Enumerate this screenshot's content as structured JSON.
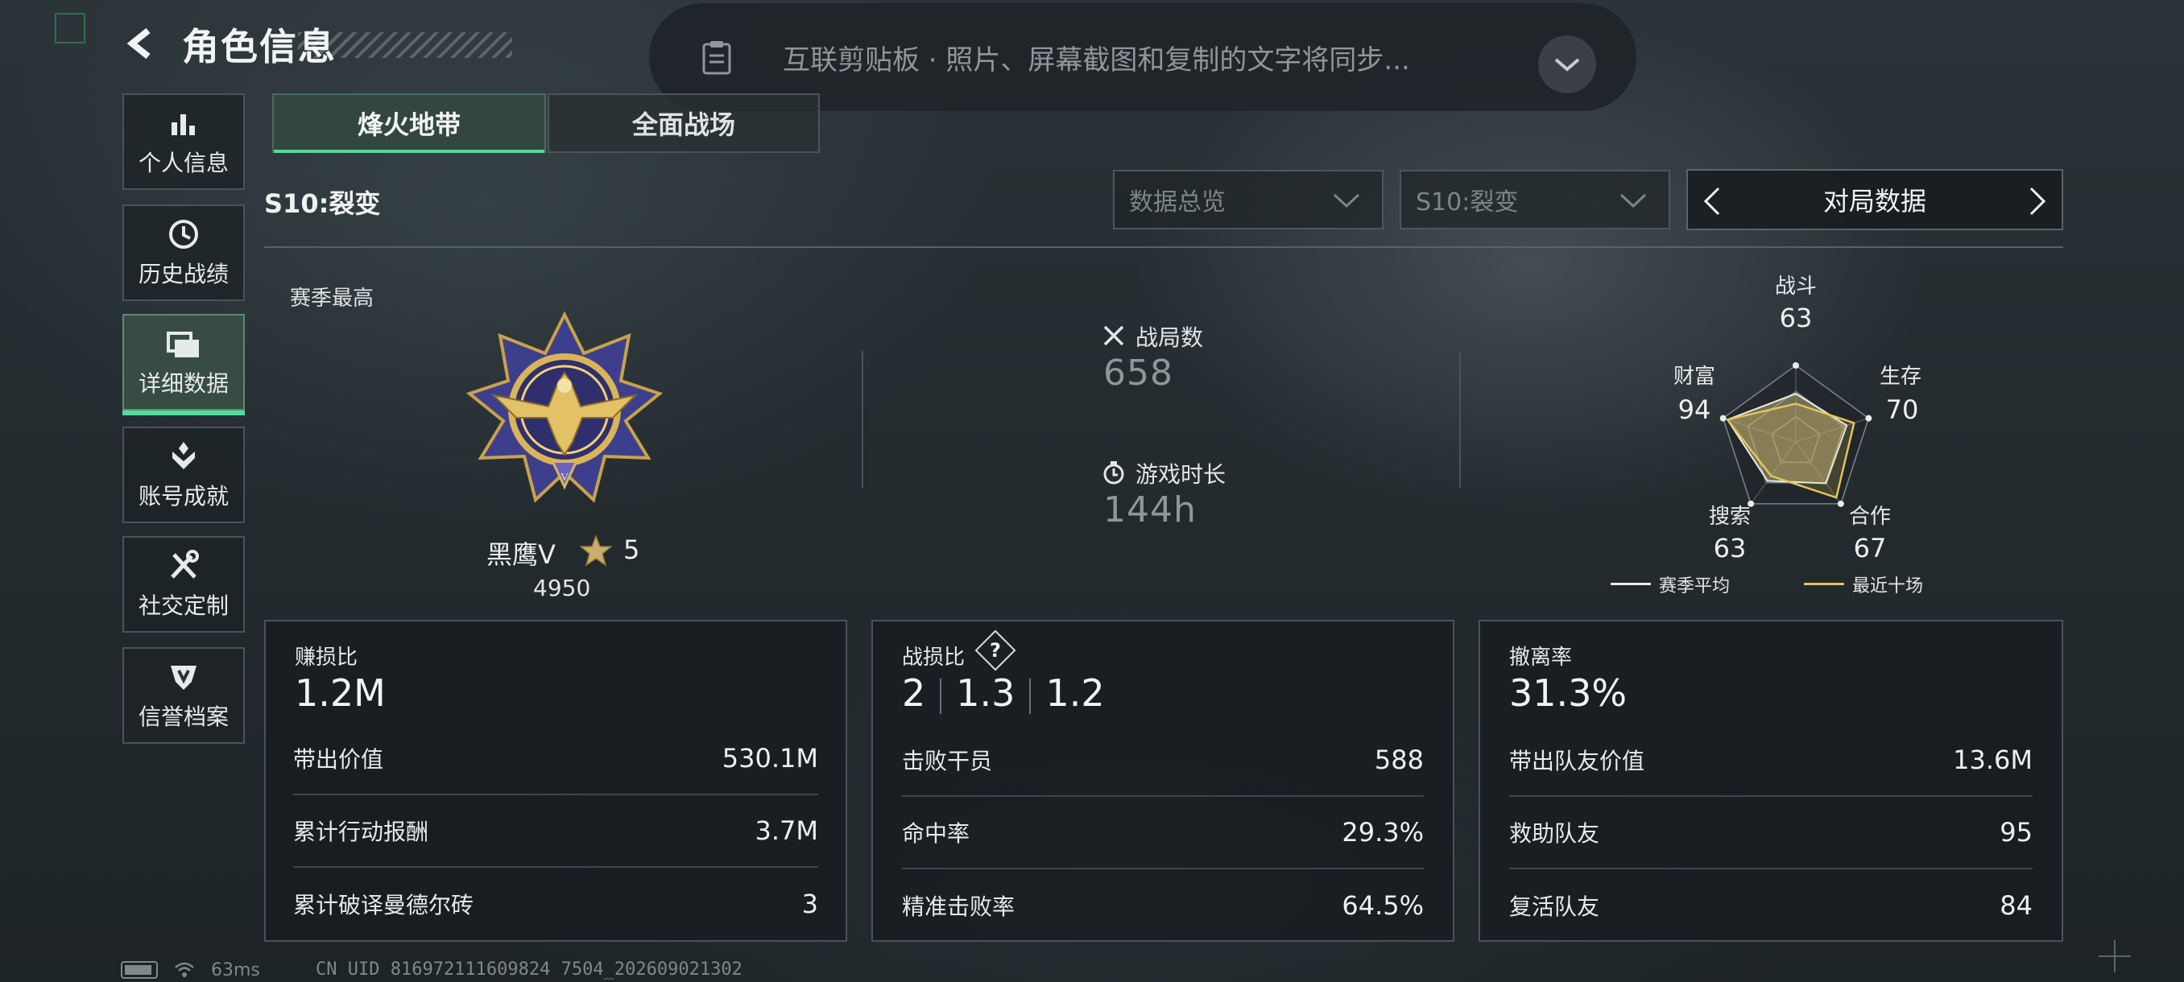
{
  "header": {
    "title": "角色信息"
  },
  "clipboard_toast": {
    "text": "互联剪贴板 · 照片、屏幕截图和复制的文字将同步..."
  },
  "sidebar": {
    "items": [
      {
        "label": "个人信息",
        "icon": "bar-chart-icon"
      },
      {
        "label": "历史战绩",
        "icon": "clock-icon"
      },
      {
        "label": "详细数据",
        "icon": "folder-icon",
        "active": true
      },
      {
        "label": "账号成就",
        "icon": "achievement-icon"
      },
      {
        "label": "社交定制",
        "icon": "tools-icon"
      },
      {
        "label": "信誉档案",
        "icon": "shield-badge-icon"
      }
    ]
  },
  "tabs": [
    {
      "label": "烽火地带",
      "active": true
    },
    {
      "label": "全面战场",
      "active": false
    }
  ],
  "season_label": "S10:裂变",
  "filters": {
    "view_dropdown": "数据总览",
    "season_dropdown": "S10:裂变",
    "pager_label": "对局数据"
  },
  "season_best": {
    "title": "赛季最高",
    "rank_name": "黑鹰Ⅴ",
    "stars": "5",
    "score": "4950"
  },
  "stats": {
    "matches_label": "战局数",
    "matches_value": "658",
    "playtime_label": "游戏时长",
    "playtime_value": "144h"
  },
  "radar": {
    "axes": [
      {
        "label": "战斗",
        "value": "63"
      },
      {
        "label": "生存",
        "value": "70"
      },
      {
        "label": "合作",
        "value": "67"
      },
      {
        "label": "搜索",
        "value": "63"
      },
      {
        "label": "财富",
        "value": "94"
      }
    ],
    "season_avg_fractions": [
      0.63,
      0.7,
      0.67,
      0.63,
      0.94
    ],
    "recent_ten_fractions": [
      0.5,
      0.8,
      0.9,
      0.55,
      0.94
    ],
    "legend": {
      "season_avg": "赛季平均",
      "recent_ten": "最近十场"
    },
    "colors": {
      "season_avg": "#e9ecec",
      "recent_ten": "#e3c55a",
      "fill": "#b8a97a"
    }
  },
  "panels": {
    "profit": {
      "title": "赚损比",
      "big": "1.2M",
      "rows": [
        {
          "label": "带出价值",
          "value": "530.1M"
        },
        {
          "label": "累计行动报酬",
          "value": "3.7M"
        },
        {
          "label": "累计破译曼德尔砖",
          "value": "3"
        }
      ]
    },
    "kd": {
      "title": "战损比",
      "help": "?",
      "ratios": [
        "2",
        "1.3",
        "1.2"
      ],
      "rows": [
        {
          "label": "击败干员",
          "value": "588"
        },
        {
          "label": "命中率",
          "value": "29.3%"
        },
        {
          "label": "精准击败率",
          "value": "64.5%"
        }
      ]
    },
    "extract": {
      "title": "撤离率",
      "big": "31.3%",
      "rows": [
        {
          "label": "带出队友价值",
          "value": "13.6M"
        },
        {
          "label": "救助队友",
          "value": "95"
        },
        {
          "label": "复活队友",
          "value": "84"
        }
      ]
    }
  },
  "status_bar": {
    "ping": "63ms",
    "uid": "CN UID 816972111609824 7504_202609021302"
  },
  "colors": {
    "accent": "#4ee09a",
    "panel_border": "#4a5357"
  }
}
